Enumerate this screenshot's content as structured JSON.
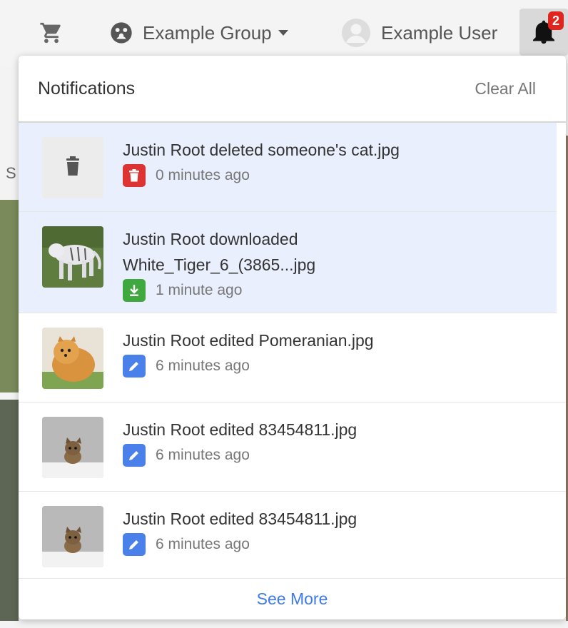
{
  "topbar": {
    "group_name": "Example Group",
    "user_name": "Example User",
    "notification_count": "2"
  },
  "background": {
    "partial_text": "S"
  },
  "notifications": {
    "title": "Notifications",
    "clear_all_label": "Clear All",
    "see_more_label": "See More",
    "items": [
      {
        "text": "Justin Root deleted someone's cat.jpg",
        "time": "0 minutes ago",
        "type": "delete",
        "unread": true,
        "thumbnail": "trash-placeholder"
      },
      {
        "text": "Justin Root downloaded White_Tiger_6_(3865...jpg",
        "time": "1 minute ago",
        "type": "download",
        "unread": true,
        "thumbnail": "white-tiger-photo"
      },
      {
        "text": "Justin Root edited Pomeranian.jpg",
        "time": "6 minutes ago",
        "type": "edit",
        "unread": false,
        "thumbnail": "pomeranian-photo"
      },
      {
        "text": "Justin Root edited 83454811.jpg",
        "time": "6 minutes ago",
        "type": "edit",
        "unread": false,
        "thumbnail": "kitten-photo"
      },
      {
        "text": "Justin Root edited 83454811.jpg",
        "time": "6 minutes ago",
        "type": "edit",
        "unread": false,
        "thumbnail": "kitten-photo"
      }
    ]
  },
  "colors": {
    "unread_bg": "#e9effc",
    "delete": "#dd3333",
    "download": "#3fa83f",
    "edit": "#4a80ea",
    "link": "#3f7ae8",
    "badge": "#e0241e"
  }
}
